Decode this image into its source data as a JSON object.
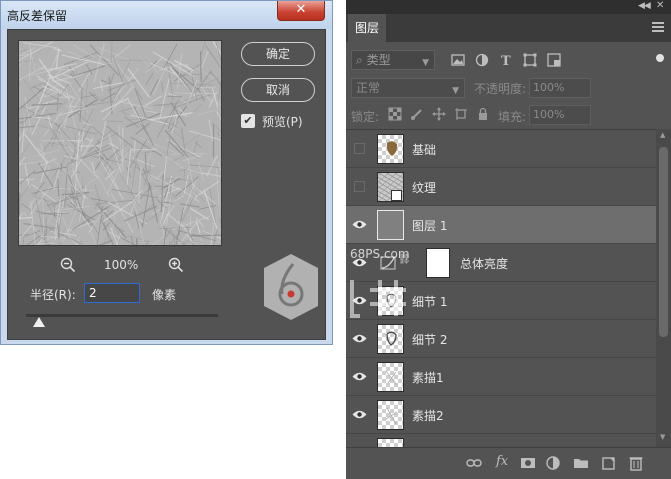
{
  "dialog": {
    "title": "高反差保留",
    "close_glyph": "✕",
    "zoom_level": "100%",
    "ok_label": "确定",
    "cancel_label": "取消",
    "preview_label": "预览(P)",
    "preview_checked": true,
    "radius_label": "半径(R):",
    "radius_value": "2",
    "radius_unit": "像素",
    "radius_slider_fraction": 0.07
  },
  "panel": {
    "tab": "图层",
    "filter_kind": "类型",
    "blend_mode": "正常",
    "opacity_label": "不透明度:",
    "opacity_value": "100%",
    "lock_label": "锁定:",
    "fill_label": "填充:",
    "fill_value": "100%",
    "layers": [
      {
        "name": "基础",
        "visible": false,
        "thumb": "checker"
      },
      {
        "name": "纹理",
        "visible": false,
        "thumb": "texture",
        "smart_object": true
      },
      {
        "name": "图层 1",
        "visible": true,
        "thumb": "solid-gray",
        "selected": true
      },
      {
        "name": "总体亮度",
        "visible": true,
        "thumb": "adjustment",
        "has_mask": true
      },
      {
        "name": "细节 1",
        "visible": true,
        "thumb": "checker"
      },
      {
        "name": "细节 2",
        "visible": true,
        "thumb": "checker"
      },
      {
        "name": "素描1",
        "visible": true,
        "thumb": "checker"
      },
      {
        "name": "素描2",
        "visible": true,
        "thumb": "checker"
      }
    ]
  },
  "watermark": {
    "site": "68PS.com"
  },
  "colors": {
    "dialog_title_bg": "#c9d8ec",
    "dialog_body_bg": "#535353",
    "panel_bg": "#535353",
    "selected_row": "#6e6e6e",
    "focus_border": "#2e6bd4",
    "close_button": "#c8402f"
  }
}
